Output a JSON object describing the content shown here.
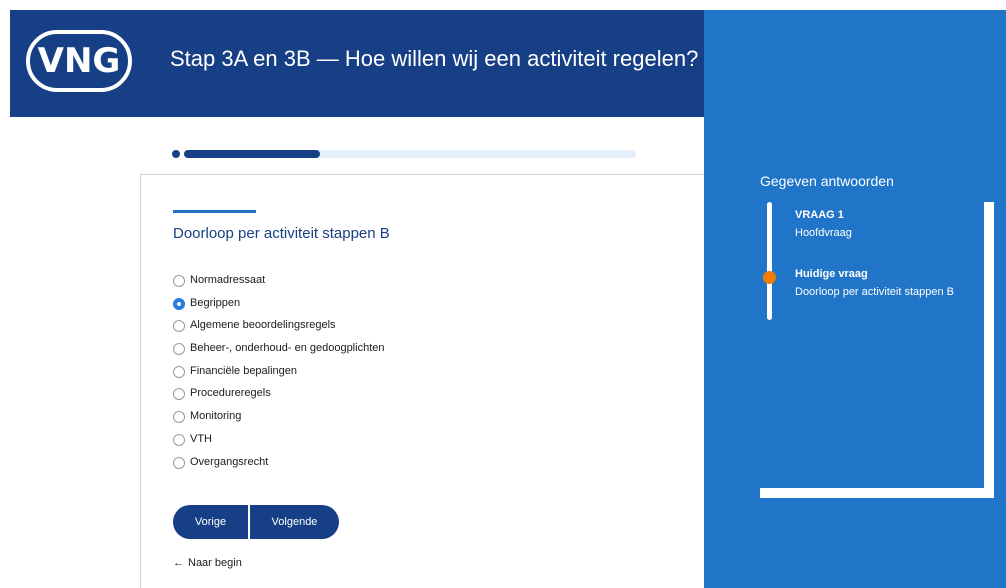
{
  "header": {
    "logo_text": "VNG",
    "title": "Stap 3A en 3B — Hoe willen wij een activiteit regelen?"
  },
  "progress": {
    "fraction": 0.3
  },
  "question": {
    "title": "Doorloop per activiteit stappen B",
    "options": [
      {
        "label": "Normadressaat",
        "checked": false
      },
      {
        "label": "Begrippen",
        "checked": true
      },
      {
        "label": "Algemene beoordelingsregels",
        "checked": false
      },
      {
        "label": "Beheer-, onderhoud- en gedoogplichten",
        "checked": false
      },
      {
        "label": "Financiële bepalingen",
        "checked": false
      },
      {
        "label": "Procedureregels",
        "checked": false
      },
      {
        "label": "Monitoring",
        "checked": false
      },
      {
        "label": "VTH",
        "checked": false
      },
      {
        "label": "Overgangsrecht",
        "checked": false
      }
    ]
  },
  "buttons": {
    "prev": "Vorige",
    "next": "Volgende"
  },
  "back_link": {
    "arrow": "←",
    "label": "Naar begin"
  },
  "answers": {
    "title": "Gegeven antwoorden",
    "items": [
      {
        "label": "VRAAG 1",
        "value": "Hoofdvraag"
      },
      {
        "label": "Huidige vraag",
        "value": "Doorloop per activiteit stappen B"
      }
    ]
  },
  "colors": {
    "header_bg": "#163f85",
    "panel_bg": "#2175c8",
    "accent_orange": "#f07d00",
    "radio_checked": "#2a7be0"
  }
}
